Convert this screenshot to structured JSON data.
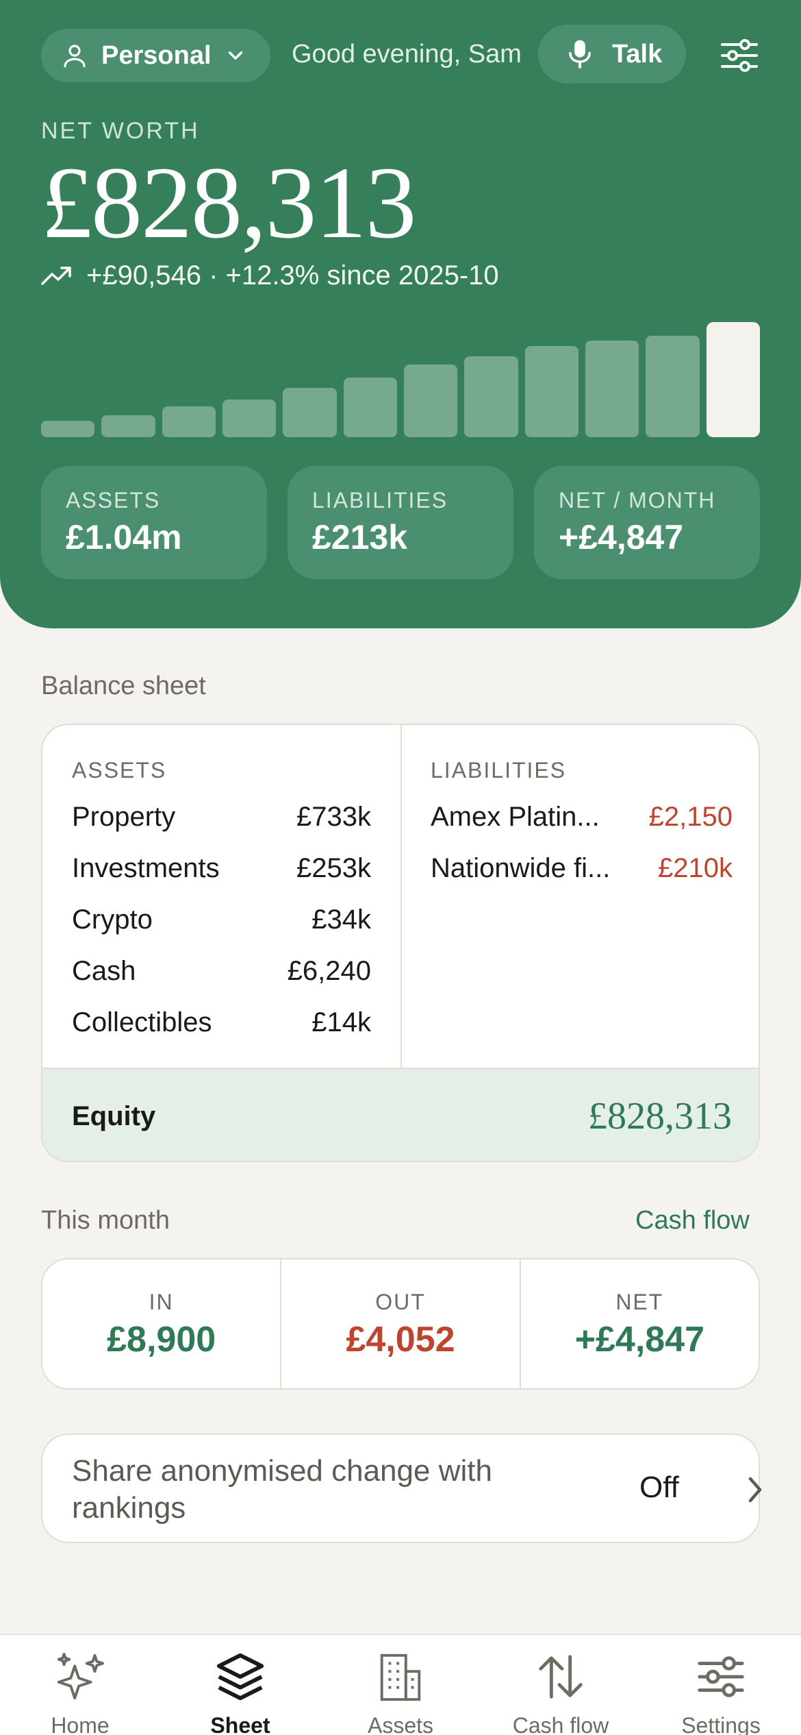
{
  "header": {
    "profile_label": "Personal",
    "greeting": "Good evening, Sam",
    "talk_label": "Talk",
    "net_worth_label": "NET WORTH",
    "net_worth_value": "£828,313",
    "change_text": "+£90,546 · +12.3% since 2025-10",
    "trend_bars": [
      0.14,
      0.19,
      0.27,
      0.33,
      0.43,
      0.52,
      0.63,
      0.7,
      0.79,
      0.84,
      0.88,
      1.0
    ],
    "stats": [
      {
        "label": "ASSETS",
        "value": "£1.04m"
      },
      {
        "label": "LIABILITIES",
        "value": "£213k"
      },
      {
        "label": "NET / MONTH",
        "value": "+£4,847"
      }
    ]
  },
  "balance_sheet": {
    "title": "Balance sheet",
    "assets_heading": "ASSETS",
    "liabilities_heading": "LIABILITIES",
    "assets": [
      {
        "name": "Property",
        "amount": "£733k"
      },
      {
        "name": "Investments",
        "amount": "£253k"
      },
      {
        "name": "Crypto",
        "amount": "£34k"
      },
      {
        "name": "Cash",
        "amount": "£6,240"
      },
      {
        "name": "Collectibles",
        "amount": "£14k"
      }
    ],
    "liabilities": [
      {
        "name": "Amex Platin...",
        "amount": "£2,150"
      },
      {
        "name": "Nationwide fi...",
        "amount": "£210k"
      }
    ],
    "equity_label": "Equity",
    "equity_value": "£828,313"
  },
  "this_month": {
    "title": "This month",
    "link_label": "Cash flow",
    "in_label": "IN",
    "in_value": "£8,900",
    "out_label": "OUT",
    "out_value": "£4,052",
    "net_label": "NET",
    "net_value": "+£4,847"
  },
  "share": {
    "text": "Share anonymised change with rankings",
    "state": "Off"
  },
  "tabbar": {
    "tabs": [
      {
        "label": "Home",
        "icon": "sparkles-icon"
      },
      {
        "label": "Sheet",
        "icon": "layers-icon",
        "active": true
      },
      {
        "label": "Assets",
        "icon": "building-icon"
      },
      {
        "label": "Cash flow",
        "icon": "arrows-up-down-icon"
      },
      {
        "label": "Settings",
        "icon": "sliders-icon"
      }
    ]
  },
  "colors": {
    "brand_green": "#35805b",
    "positive": "#2e7a55",
    "negative": "#c0442b",
    "background": "#f5f3ef"
  }
}
